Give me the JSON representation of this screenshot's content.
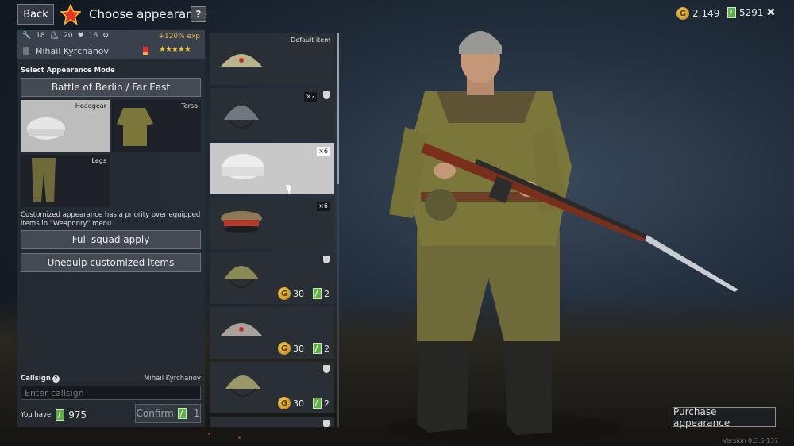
{
  "header": {
    "back_label": "Back",
    "title": "Choose appearance",
    "help_label": "?",
    "gold_amount": "2,149",
    "tickets_amount": "5291",
    "close_label": "✖"
  },
  "soldier": {
    "stats": [
      "18",
      "20",
      "16"
    ],
    "exp_bonus": "+120% exp",
    "name": "Mihail Kyrchanov",
    "stars": "★★★★★"
  },
  "left_panel": {
    "mode_label": "Select Appearance Mode",
    "mode_button": "Battle of Berlin / Far East",
    "slots": [
      {
        "label": "Headgear"
      },
      {
        "label": "Torso"
      },
      {
        "label": "Legs"
      }
    ],
    "note": "Customized appearance has a priority over equipped items in \"Weaponry\" menu",
    "squad_apply": "Full squad apply",
    "unequip": "Unequip customized items",
    "callsign_label": "Callsign",
    "callsign_value": "Mihail Kyrchanov",
    "callsign_placeholder": "Enter callsign",
    "you_have_label": "You have",
    "you_have_amount": "975",
    "confirm_label": "Confirm",
    "confirm_cost": "1"
  },
  "items": [
    {
      "caption": "Default item"
    },
    {
      "badge": "×2"
    },
    {
      "badge": "×6"
    },
    {
      "badge": "×6"
    },
    {
      "gold": "30",
      "tickets": "2"
    },
    {
      "gold": "30",
      "tickets": "2"
    },
    {
      "gold": "30",
      "tickets": "2"
    }
  ],
  "footer": {
    "purchase_label": "Purchase appearance",
    "version": "Version 0.3.5.137"
  },
  "icons": {
    "coin_glyph": "G",
    "star": "star-icon",
    "shield": "shield-icon"
  }
}
